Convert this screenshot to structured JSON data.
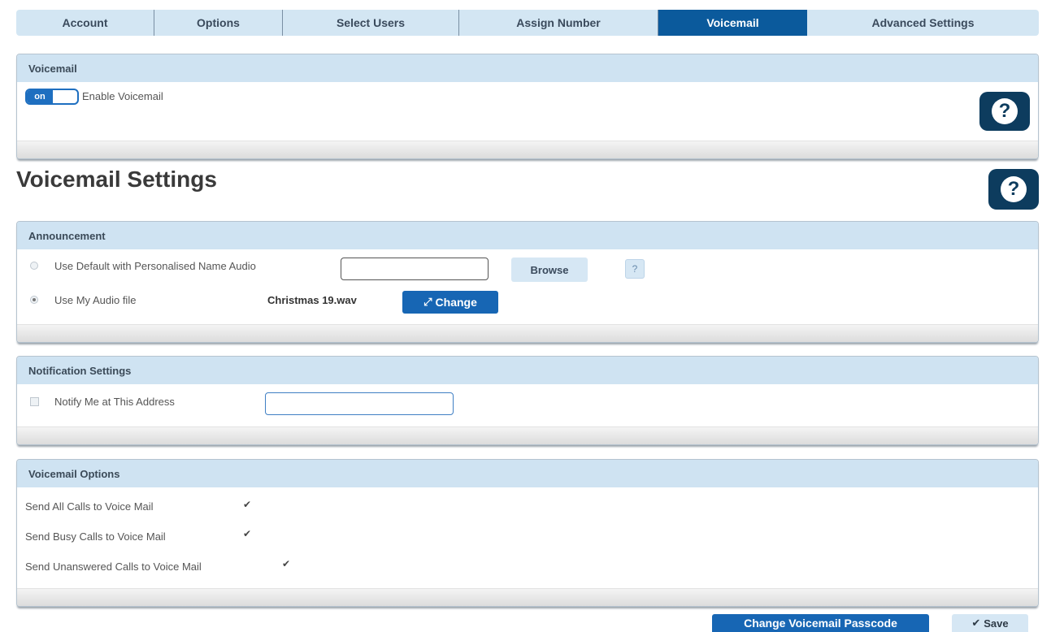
{
  "tabs": [
    {
      "label": "Account",
      "active": false
    },
    {
      "label": "Options",
      "active": false
    },
    {
      "label": "Select Users",
      "active": false
    },
    {
      "label": "Assign Number",
      "active": false
    },
    {
      "label": "Voicemail",
      "active": true
    },
    {
      "label": "Advanced Settings",
      "active": false
    }
  ],
  "voicemail_panel": {
    "header": "Voicemail",
    "toggle_state": "on",
    "enable_label": "Enable Voicemail",
    "help_icon": "question-icon"
  },
  "settings": {
    "title": "Voicemail Settings",
    "help_icon": "question-icon"
  },
  "announcement": {
    "header": "Announcement",
    "option_default_label": "Use Default with Personalised Name Audio",
    "option_default_value": "",
    "browse_label": "Browse",
    "small_help": "?",
    "option_file_label": "Use My Audio file",
    "file_name": "Christmas 19.wav",
    "change_label": "Change",
    "change_icon": "swap-arrows-icon"
  },
  "notification": {
    "header": "Notification Settings",
    "notify_label": "Notify Me at This Address",
    "notify_value": ""
  },
  "options": {
    "header": "Voicemail Options",
    "items": [
      {
        "label": "Send All Calls to Voice Mail",
        "checked": true
      },
      {
        "label": "Send Busy Calls to Voice Mail",
        "checked": true
      },
      {
        "label": "Send Unanswered Calls to Voice Mail",
        "checked": true
      }
    ]
  },
  "footer": {
    "passcode_label": "Change Voicemail Passcode",
    "save_label": "Save",
    "save_icon": "checkmark-icon"
  },
  "colors": {
    "active_tab": "#0b5a9c",
    "tab_bg": "#d3e6f3",
    "header_bg": "#cfe3f2",
    "primary_button": "#1766b4",
    "help_button": "#0d3c5e"
  }
}
